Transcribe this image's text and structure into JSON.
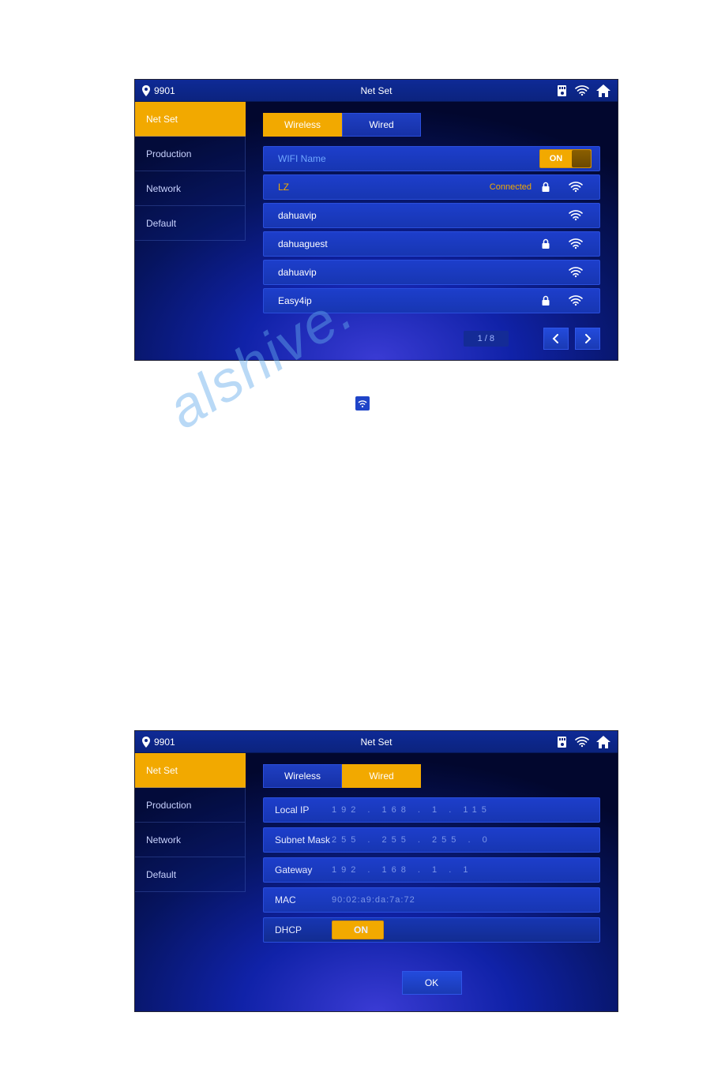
{
  "header": {
    "pin_id": "9901",
    "title": "Net Set"
  },
  "sidebar": {
    "items": [
      {
        "label": "Net Set",
        "active": true
      },
      {
        "label": "Production",
        "active": false
      },
      {
        "label": "Network",
        "active": false
      },
      {
        "label": "Default",
        "active": false
      }
    ]
  },
  "screens": {
    "wireless": {
      "tabs": {
        "wireless": "Wireless",
        "wired": "Wired"
      },
      "header_label": "WIFI Name",
      "toggle_label": "ON",
      "networks": [
        {
          "name": "LZ",
          "status": "Connected",
          "locked": true,
          "signal": "strong"
        },
        {
          "name": "dahuavip",
          "status": "",
          "locked": false,
          "signal": "strong"
        },
        {
          "name": "dahuaguest",
          "status": "",
          "locked": true,
          "signal": "strong"
        },
        {
          "name": "dahuavip",
          "status": "",
          "locked": false,
          "signal": "strong"
        },
        {
          "name": "Easy4ip",
          "status": "",
          "locked": true,
          "signal": "strong"
        }
      ],
      "pagination": {
        "current": 1,
        "total": 8,
        "text": "1 / 8"
      }
    },
    "wired": {
      "tabs": {
        "wireless": "Wireless",
        "wired": "Wired"
      },
      "fields": {
        "local_ip": {
          "label": "Local IP",
          "value": "192 . 168 .   1 .  115"
        },
        "subnet": {
          "label": "Subnet Mask",
          "value": "255 . 255 . 255 .    0"
        },
        "gateway": {
          "label": "Gateway",
          "value": "192 . 168 .   1 .    1"
        },
        "mac": {
          "label": "MAC",
          "value": "90:02:a9:da:7a:72"
        },
        "dhcp": {
          "label": "DHCP",
          "toggle": "ON"
        }
      },
      "ok": "OK"
    }
  }
}
